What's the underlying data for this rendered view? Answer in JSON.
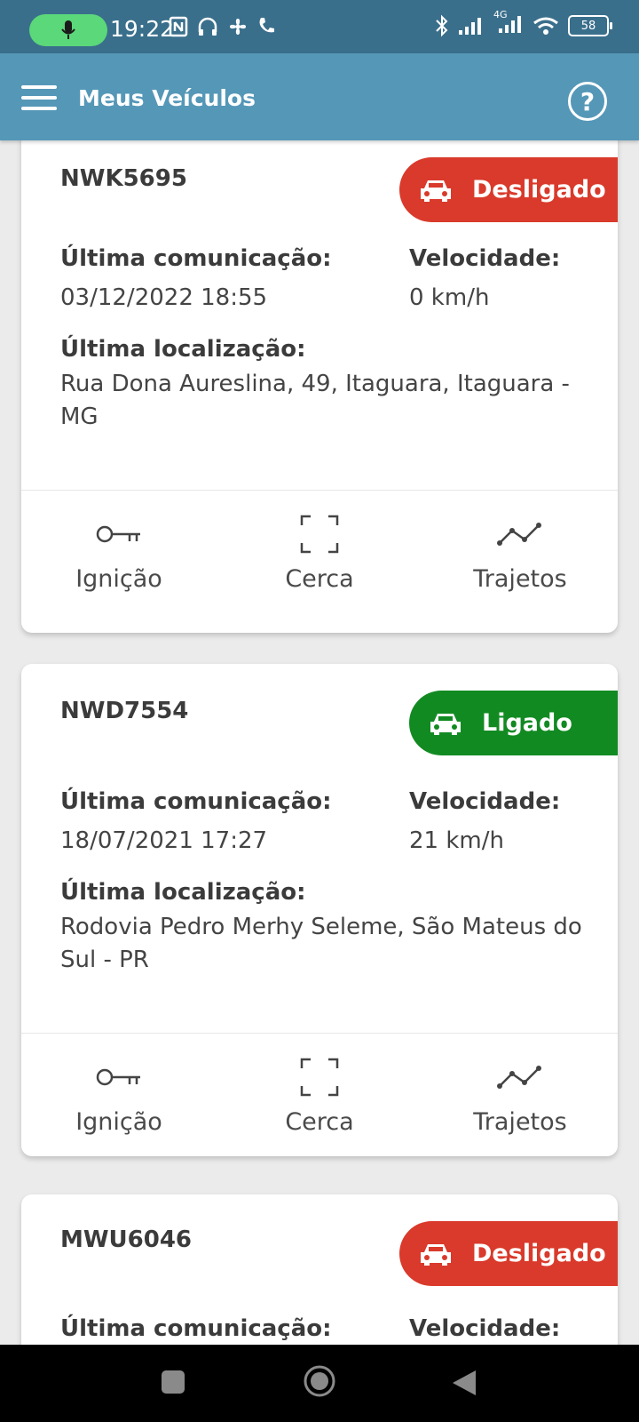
{
  "status_bar": {
    "time": "19:22",
    "battery": "58",
    "network": "4G"
  },
  "app_bar": {
    "title": "Meus Veículos"
  },
  "vehicles": [
    {
      "plate": "NWK5695",
      "status": "Desligado",
      "last_comm_label": "Última comunicação:",
      "last_comm": "03/12/2022 18:55",
      "speed_label": "Velocidade:",
      "speed": "0 km/h",
      "location_label": "Última localização:",
      "location": "Rua Dona Aureslina, 49, Itaguara, Itaguara - MG",
      "actions": [
        "Ignição",
        "Cerca",
        "Trajetos"
      ]
    },
    {
      "plate": "NWD7554",
      "status": "Ligado",
      "last_comm_label": "Última comunicação:",
      "last_comm": "18/07/2021 17:27",
      "speed_label": "Velocidade:",
      "speed": "21 km/h",
      "location_label": "Última localização:",
      "location": "Rodovia Pedro Merhy Seleme, São Mateus do Sul - PR",
      "actions": [
        "Ignição",
        "Cerca",
        "Trajetos"
      ]
    },
    {
      "plate": "MWU6046",
      "status": "Desligado",
      "last_comm_label": "Última comunicação:",
      "speed_label": "Velocidade:"
    }
  ],
  "colors": {
    "app_bar": "#5597b7",
    "status_bar": "#3a6f8c",
    "off": "#d93a2b",
    "on": "#128a22"
  },
  "icons": [
    "mic-icon",
    "menu-icon",
    "help-icon",
    "car-icon",
    "key-icon",
    "fence-icon",
    "route-icon",
    "nav-square-icon",
    "nav-home-icon",
    "nav-back-icon"
  ]
}
